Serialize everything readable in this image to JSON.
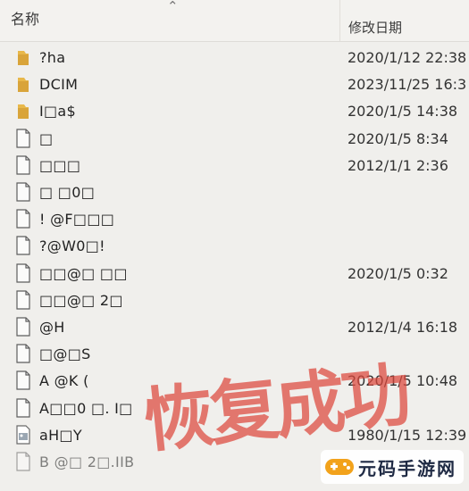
{
  "header": {
    "name_label": "名称",
    "date_label": "修改日期"
  },
  "files": [
    {
      "icon": "folder-icon",
      "name": "?ha",
      "date": "2020/1/12 22:38"
    },
    {
      "icon": "folder-icon",
      "name": "DCIM",
      "date": "2023/11/25 16:3"
    },
    {
      "icon": "folder-icon",
      "name": "I□a$",
      "date": "2020/1/5 14:38"
    },
    {
      "icon": "file-icon",
      "name": "□",
      "date": "2020/1/5 8:34"
    },
    {
      "icon": "file-icon",
      "name": " □□□",
      "date": "2012/1/1 2:36"
    },
    {
      "icon": "file-icon",
      "name": "□ □0□",
      "date": ""
    },
    {
      "icon": "file-icon",
      "name": "! @F□□□",
      "date": ""
    },
    {
      "icon": "file-icon",
      "name": "?@W0□!",
      "date": ""
    },
    {
      "icon": "file-icon",
      "name": "□□@□ □□",
      "date": "2020/1/5 0:32"
    },
    {
      "icon": "file-icon",
      "name": "□□@□ 2□",
      "date": ""
    },
    {
      "icon": "file-icon",
      "name": "@H",
      "date": "2012/1/4 16:18"
    },
    {
      "icon": "file-icon",
      "name": "□@□S",
      "date": ""
    },
    {
      "icon": "file-icon",
      "name": "A @K (",
      "date": "2020/1/5 10:48"
    },
    {
      "icon": "file-icon",
      "name": " A□□0 □. I□",
      "date": ""
    },
    {
      "icon": "image-file-icon",
      "name": "aH□Y",
      "date": "1980/1/15 12:39"
    },
    {
      "icon": "file-icon",
      "name": "B @□ 2□.IIB",
      "date": ""
    }
  ],
  "watermark": {
    "text": "恢复成功",
    "color": "#dc463c"
  },
  "site_logo": {
    "text": "元码手游网"
  },
  "colors": {
    "folder": "#e8b84a",
    "background": "#f0efec"
  }
}
